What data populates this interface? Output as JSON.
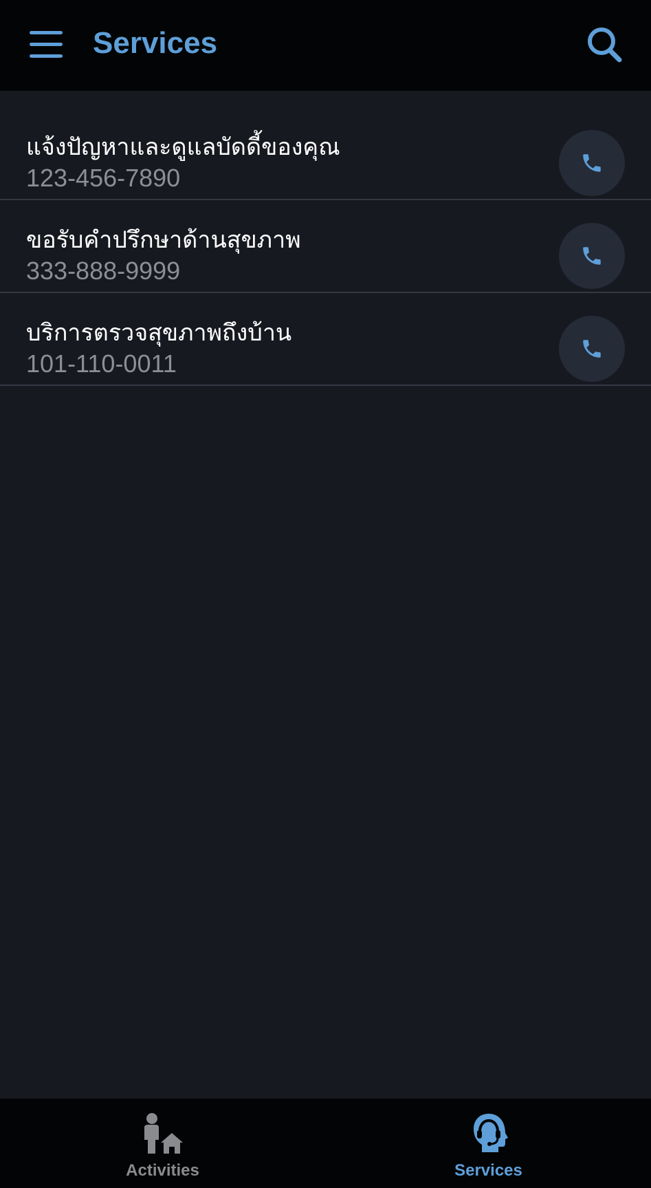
{
  "header": {
    "title": "Services",
    "menu_icon": "hamburger-menu-icon",
    "search_icon": "search-icon"
  },
  "services": [
    {
      "title": "แจ้งปัญหาและดูแลบัดดี้ของคุณ",
      "phone": "123-456-7890",
      "icon": "phone-icon"
    },
    {
      "title": "ขอรับคำปรึกษาด้านสุขภาพ",
      "phone": "333-888-9999",
      "icon": "phone-icon"
    },
    {
      "title": "บริการตรวจสุขภาพถึงบ้าน",
      "phone": "101-110-0011",
      "icon": "phone-icon"
    }
  ],
  "bottom_nav": {
    "items": [
      {
        "label": "Activities",
        "icon": "person-home-icon",
        "active": false
      },
      {
        "label": "Services",
        "icon": "customer-service-headset-icon",
        "active": true
      }
    ]
  },
  "colors": {
    "accent": "#5e9fd9",
    "background": "#171920",
    "header_background": "#030405",
    "inactive_nav": "#8a8b8e",
    "secondary_text": "#8c8f95"
  }
}
